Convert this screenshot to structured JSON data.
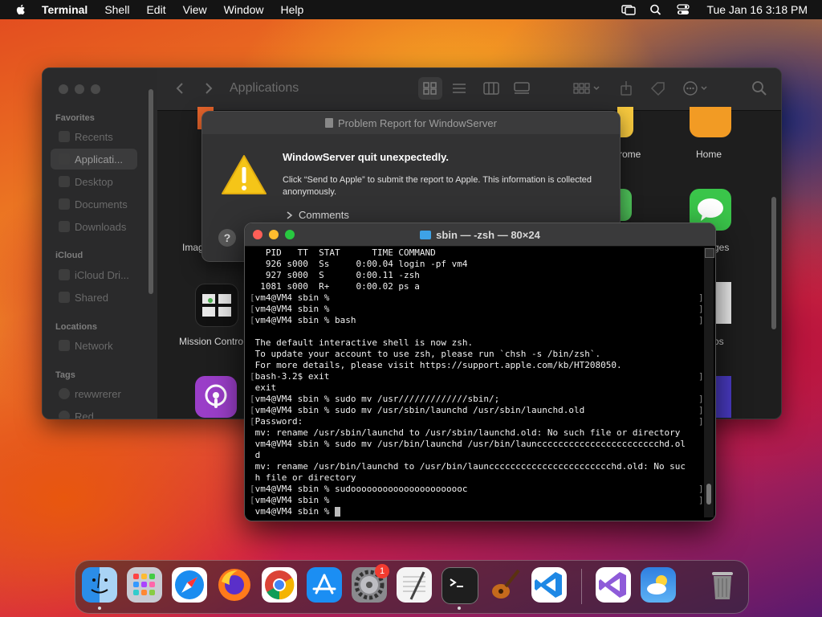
{
  "menubar": {
    "app_name": "Terminal",
    "items": [
      "Shell",
      "Edit",
      "View",
      "Window",
      "Help"
    ],
    "clock": "Tue Jan 16  3:18 PM"
  },
  "finder": {
    "title": "Applications",
    "sidebar": {
      "favorites_label": "Favorites",
      "favorites": [
        "Recents",
        "Applicati...",
        "Desktop",
        "Documents",
        "Downloads"
      ],
      "icloud_label": "iCloud",
      "icloud": [
        "iCloud Dri...",
        "Shared"
      ],
      "locations_label": "Locations",
      "locations": [
        "Network"
      ],
      "tags_label": "Tags",
      "tags": [
        "rewwrerer",
        "Red"
      ]
    },
    "apps": {
      "chrome_label": "rome",
      "home_label": "Home",
      "image_label": "Imag",
      "messages_label": "ges",
      "mission_label": "Mission Contro",
      "photos_label": "os"
    }
  },
  "report": {
    "title": "Problem Report for WindowServer",
    "headline": "WindowServer quit unexpectedly.",
    "desc": "Click “Send to Apple” to submit the report to Apple. This information is collected anonymously.",
    "comments": "Comments",
    "help": "?"
  },
  "terminal": {
    "title": "sbin — -zsh — 80×24",
    "lines": [
      {
        "t": "  PID   TT  STAT      TIME COMMAND",
        "b": false
      },
      {
        "t": "  926 s000  Ss     0:00.04 login -pf vm4",
        "b": false
      },
      {
        "t": "  927 s000  S      0:00.11 -zsh",
        "b": false
      },
      {
        "t": " 1081 s000  R+     0:00.02 ps a",
        "b": false
      },
      {
        "t": "vm4@VM4 sbin %",
        "b": true
      },
      {
        "t": "vm4@VM4 sbin %",
        "b": true
      },
      {
        "t": "vm4@VM4 sbin % bash",
        "b": true
      },
      {
        "t": "",
        "b": false
      },
      {
        "t": "The default interactive shell is now zsh.",
        "b": false
      },
      {
        "t": "To update your account to use zsh, please run `chsh -s /bin/zsh`.",
        "b": false
      },
      {
        "t": "For more details, please visit https://support.apple.com/kb/HT208050.",
        "b": false
      },
      {
        "t": "bash-3.2$ exit",
        "b": true
      },
      {
        "t": "exit",
        "b": false
      },
      {
        "t": "vm4@VM4 sbin % sudo mv /usr/////////////sbin/;",
        "b": true
      },
      {
        "t": "vm4@VM4 sbin % sudo mv /usr/sbin/launchd /usr/sbin/launchd.old",
        "b": true
      },
      {
        "t": "Password:",
        "b": true
      },
      {
        "t": "mv: rename /usr/sbin/launchd to /usr/sbin/launchd.old: No such file or directory",
        "b": false
      },
      {
        "t": "vm4@VM4 sbin % sudo mv /usr/bin/launchd /usr/bin/launccccccccccccccccccccccchd.ol",
        "b": false
      },
      {
        "t": "d",
        "b": false
      },
      {
        "t": "mv: rename /usr/bin/launchd to /usr/bin/launccccccccccccccccccccccchd.old: No suc",
        "b": false
      },
      {
        "t": "h file or directory",
        "b": false
      },
      {
        "t": "vm4@VM4 sbin % sudoooooooooooooooooooooc",
        "b": true
      },
      {
        "t": "vm4@VM4 sbin %",
        "b": true
      },
      {
        "t": "vm4@VM4 sbin % ",
        "b": false,
        "cursor": true
      }
    ]
  },
  "dock": {
    "badge_count": "1",
    "apps": [
      "finder",
      "launchpad",
      "safari",
      "firefox",
      "chrome",
      "app-store",
      "system-settings",
      "textedit",
      "terminal",
      "garageband",
      "vscode",
      "visual-studio",
      "weather",
      "trash"
    ]
  },
  "colors": {
    "menubar": "#141414",
    "terminal_bg": "#000000",
    "warning": "#f5c518",
    "badge": "#f23b30"
  }
}
